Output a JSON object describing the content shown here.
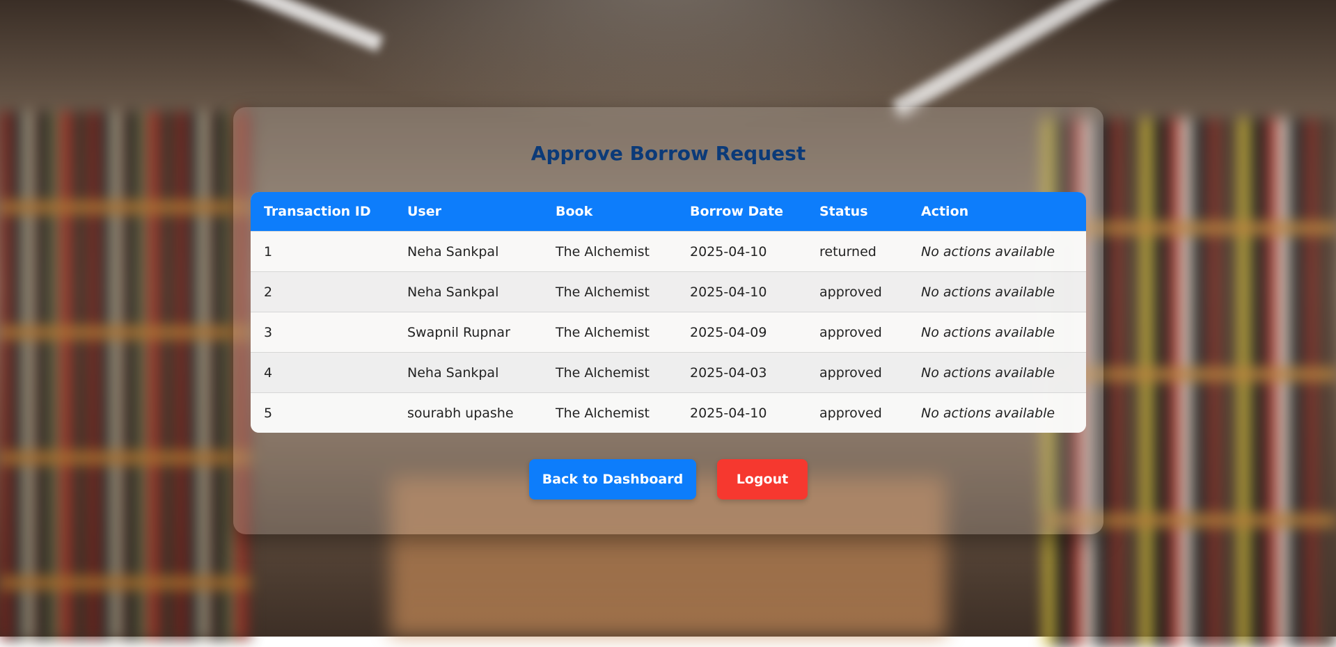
{
  "page": {
    "title": "Approve Borrow Request"
  },
  "table": {
    "headers": [
      "Transaction ID",
      "User",
      "Book",
      "Borrow Date",
      "Status",
      "Action"
    ],
    "rows": [
      {
        "id": "1",
        "user": "Neha Sankpal",
        "book": "The Alchemist",
        "date": "2025-04-10",
        "status": "returned",
        "action": "No actions available"
      },
      {
        "id": "2",
        "user": "Neha Sankpal",
        "book": "The Alchemist",
        "date": "2025-04-10",
        "status": "approved",
        "action": "No actions available"
      },
      {
        "id": "3",
        "user": "Swapnil Rupnar",
        "book": "The Alchemist",
        "date": "2025-04-09",
        "status": "approved",
        "action": "No actions available"
      },
      {
        "id": "4",
        "user": "Neha Sankpal",
        "book": "The Alchemist",
        "date": "2025-04-03",
        "status": "approved",
        "action": "No actions available"
      },
      {
        "id": "5",
        "user": "sourabh upashe",
        "book": "The Alchemist",
        "date": "2025-04-10",
        "status": "approved",
        "action": "No actions available"
      }
    ]
  },
  "buttons": {
    "back_label": "Back to Dashboard",
    "logout_label": "Logout"
  },
  "colors": {
    "primary": "#0d7dfb",
    "danger": "#f6382f",
    "title": "#0b3a78"
  }
}
